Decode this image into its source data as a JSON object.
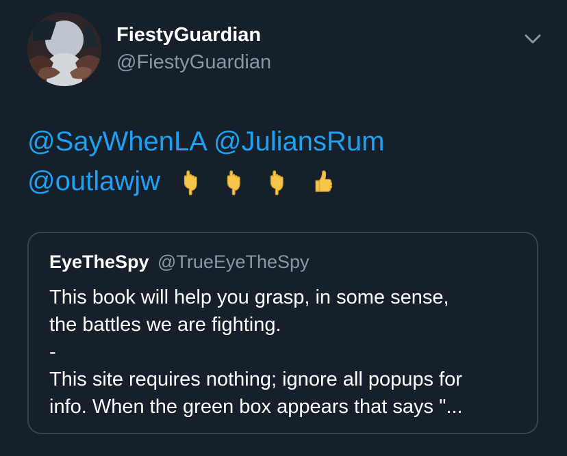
{
  "tweet": {
    "author_name": "FiestyGuardian",
    "author_handle": "@FiestyGuardian",
    "mentions": [
      "@SayWhenLA",
      "@JuliansRum",
      "@outlawjw"
    ],
    "emoji_icons": [
      "pointing-down-hand-icon",
      "pointing-down-hand-icon",
      "pointing-down-hand-icon",
      "thumbs-up-icon"
    ]
  },
  "quote": {
    "author_name": "EyeTheSpy",
    "author_handle": "@TrueEyeTheSpy",
    "lines": [
      "This book will help you grasp, in some sense,",
      "the battles we are fighting.",
      "-",
      "This site requires nothing; ignore all popups for",
      "info. When the green box appears that says \"..."
    ]
  },
  "colors": {
    "background": "#15202b",
    "accent": "#1da1f2",
    "secondary_text": "#8899a6",
    "primary_text": "#ffffff",
    "border": "#38444d"
  },
  "icons": {
    "avatar": "profile-avatar",
    "more": "chevron-down-icon"
  }
}
